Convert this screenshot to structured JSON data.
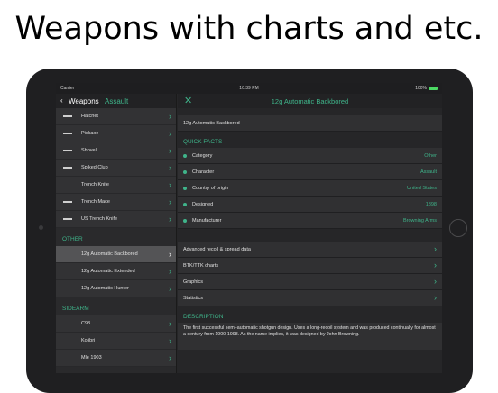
{
  "headline": "Weapons with charts and etc.",
  "status": {
    "carrier": "Carrier",
    "time": "10:39 PM",
    "battery": "100%"
  },
  "master": {
    "back_label": "Weapons",
    "title": "Assault",
    "items": [
      {
        "label": "Hatchet"
      },
      {
        "label": "Pickaxe"
      },
      {
        "label": "Shovel"
      },
      {
        "label": "Spiked Club"
      },
      {
        "label": "Trench Knife"
      },
      {
        "label": "Trench Mace"
      },
      {
        "label": "US Trench Knife"
      }
    ],
    "other_header": "OTHER",
    "other_items": [
      {
        "label": "12g Automatic Backbored",
        "selected": true
      },
      {
        "label": "12g Automatic Extended"
      },
      {
        "label": "12g Automatic Hunter"
      }
    ],
    "sidearm_header": "SIDEARM",
    "sidearm_items": [
      {
        "label": "C93"
      },
      {
        "label": "Kolibri"
      },
      {
        "label": "Mle 1903"
      }
    ]
  },
  "detail": {
    "title": "12g Automatic Backbored",
    "name_row": "12g Automatic Backbored",
    "quick_facts_header": "QUICK FACTS",
    "facts": [
      {
        "label": "Category",
        "value": "Other"
      },
      {
        "label": "Character",
        "value": "Assault"
      },
      {
        "label": "Country of origin",
        "value": "United States"
      },
      {
        "label": "Designed",
        "value": "1898"
      },
      {
        "label": "Manufacturer",
        "value": "Browning Arms"
      }
    ],
    "links": [
      {
        "label": "Advanced recoil & spread data"
      },
      {
        "label": "BTK/TTK charts"
      },
      {
        "label": "Graphics"
      },
      {
        "label": "Statistics"
      }
    ],
    "description_header": "DESCRIPTION",
    "description": "The first successful semi-automatic shotgun design. Uses a long-recoil system and was produced continually for almost a century from 1900-1998. As the name implies, it was designed by John Browning."
  },
  "colors": {
    "accent": "#3fb48a",
    "background": "#262628"
  }
}
